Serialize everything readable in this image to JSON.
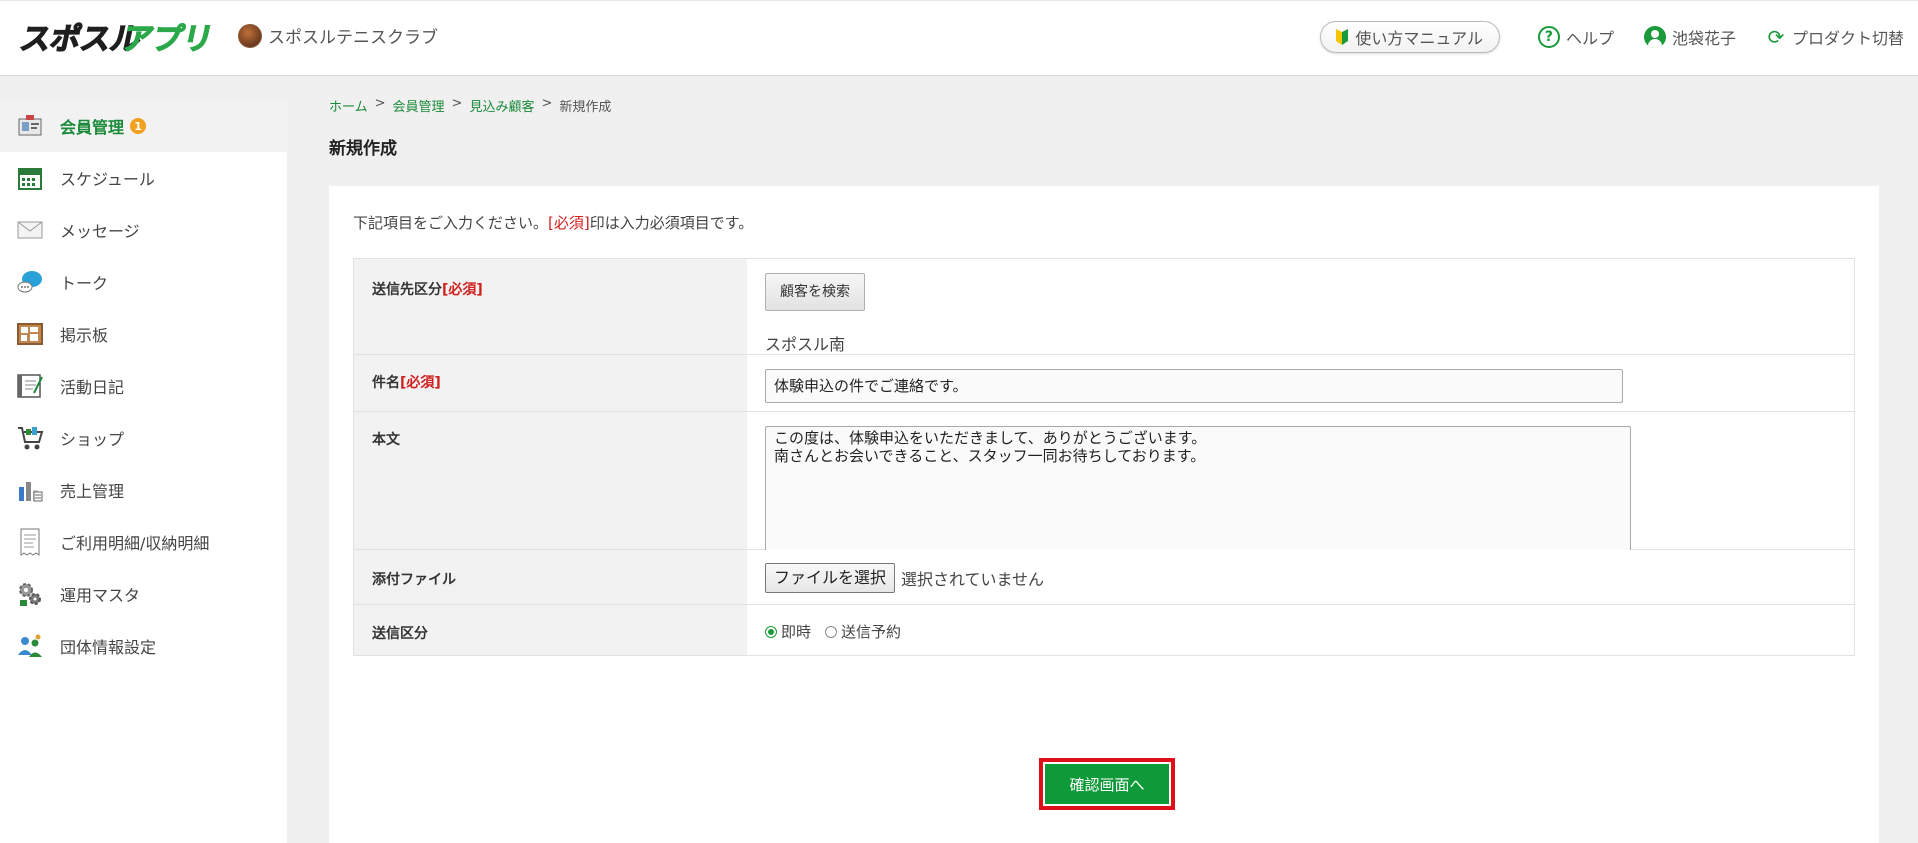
{
  "header": {
    "app_logo_text": "スポスルアプリ",
    "org_name": "スポスルテニスクラブ",
    "manual_label": "使い方マニュアル",
    "help_label": "ヘルプ",
    "user_name": "池袋花子",
    "product_switch_label": "プロダクト切替"
  },
  "sidebar": {
    "items": [
      {
        "label": "会員管理",
        "badge": "1",
        "icon": "member-card-icon"
      },
      {
        "label": "スケジュール",
        "icon": "calendar-icon"
      },
      {
        "label": "メッセージ",
        "icon": "envelope-icon"
      },
      {
        "label": "トーク",
        "icon": "chat-bubble-icon"
      },
      {
        "label": "掲示板",
        "icon": "bulletin-board-icon"
      },
      {
        "label": "活動日記",
        "icon": "diary-icon"
      },
      {
        "label": "ショップ",
        "icon": "shopping-cart-icon"
      },
      {
        "label": "売上管理",
        "icon": "sales-chart-icon"
      },
      {
        "label": "ご利用明細/収納明細",
        "icon": "receipt-icon"
      },
      {
        "label": "運用マスタ",
        "icon": "gears-icon"
      },
      {
        "label": "団体情報設定",
        "icon": "group-settings-icon"
      }
    ]
  },
  "breadcrumb": [
    "ホーム",
    "会員管理",
    "見込み顧客",
    "新規作成"
  ],
  "breadcrumb_sep": ">",
  "page_title": "新規作成",
  "form": {
    "intro_before": "下記項目をご入力ください。",
    "intro_required": "[必須]",
    "intro_after": "印は入力必須項目です。",
    "required_tag": "[必須]",
    "recipient": {
      "label": "送信先区分",
      "search_button": "顧客を検索",
      "selected": "スポスル南"
    },
    "subject": {
      "label": "件名",
      "value": "体験申込の件でご連絡です。"
    },
    "body": {
      "label": "本文",
      "line1": "この度は、体験申込をいただきまして、ありがとうございます。",
      "line2": "南さんとお会いできること、スタッフ一同お待ちしております。"
    },
    "attachment": {
      "label": "添付ファイル",
      "button": "ファイルを選択",
      "status": "選択されていません"
    },
    "send_type": {
      "label": "送信区分",
      "option_now": "即時",
      "option_scheduled": "送信予約"
    },
    "confirm_button": "確認画面へ"
  },
  "colors": {
    "brand_green": "#1a9a3a",
    "required_red": "#d02020",
    "highlight_red": "#e0101a",
    "badge_orange": "#f2a020"
  }
}
